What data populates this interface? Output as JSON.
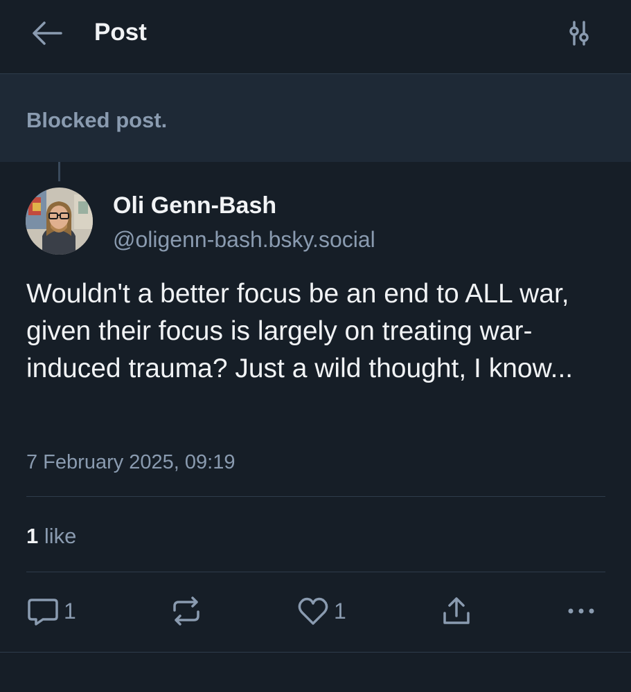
{
  "header": {
    "title": "Post",
    "back_icon": "arrow-left-icon",
    "settings_icon": "sliders-icon"
  },
  "blocked": {
    "text": "Blocked post."
  },
  "post": {
    "author_name": "Oli Genn-Bash",
    "author_handle": "@oligenn-bash.bsky.social",
    "text": "Wouldn't a better focus be an end to ALL war, given their focus is largely on treating war-induced trauma? Just a wild thought, I know...",
    "timestamp": "7 February 2025, 09:19"
  },
  "stats": {
    "likes_count": "1",
    "likes_label": "like"
  },
  "actions": {
    "reply_count": "1",
    "like_count": "1",
    "reply_icon": "comment-icon",
    "repost_icon": "repost-icon",
    "like_icon": "heart-icon",
    "share_icon": "share-icon",
    "more_icon": "more-options-icon"
  },
  "colors": {
    "background": "#161e27",
    "blocked_background": "#1e2936",
    "text_primary": "#f1f3f5",
    "text_secondary": "#8a9bb0",
    "divider": "#2e3c4b"
  }
}
